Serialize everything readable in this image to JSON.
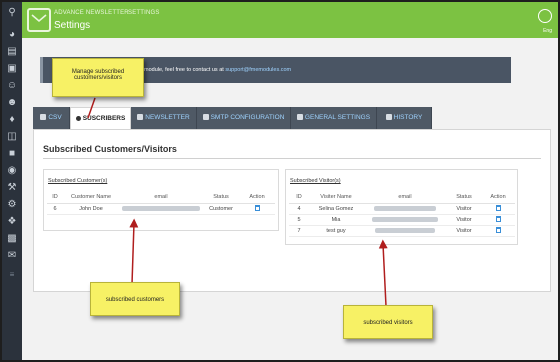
{
  "header": {
    "breadcrumb": [
      "ADVANCE NEWSLETTER",
      "SETTINGS"
    ],
    "title": "Settings",
    "lang": "Eng",
    "color": "#7cc242"
  },
  "sidebar": {
    "icons": [
      "search-icon",
      "dashboard-icon",
      "catalog-icon",
      "orders-icon",
      "customers-icon",
      "users-icon",
      "tags-icon",
      "cart-icon",
      "shipping-icon",
      "globe-icon",
      "wrench-icon",
      "settings-icon",
      "modules-icon",
      "stats-icon",
      "mail-icon",
      "collapse-icon"
    ]
  },
  "info": {
    "text_prefix": "module, feel free to contact us at",
    "email": "support@fmemodules.com"
  },
  "tabs": [
    {
      "label": "CSV",
      "icon": "csv-icon"
    },
    {
      "label": "SUSCRIBERS",
      "icon": "user-icon"
    },
    {
      "label": "NEWSLETTER",
      "icon": "newsletter-icon"
    },
    {
      "label": "SMTP CONFIGURATION",
      "icon": "smtp-icon"
    },
    {
      "label": "GENERAL SETTINGS",
      "icon": "settings-icon"
    },
    {
      "label": "HISTORY",
      "icon": "history-icon"
    }
  ],
  "panel": {
    "title": "Subscribed Customers/Visitors"
  },
  "customers": {
    "title": "Subscribed Customer(s)",
    "columns": [
      "ID",
      "Customer Name",
      "email",
      "Status",
      "Action"
    ],
    "rows": [
      {
        "id": "6",
        "name": "John Doe",
        "status": "Customer"
      }
    ]
  },
  "visitors": {
    "title": "Subscribed Visitor(s)",
    "columns": [
      "ID",
      "Visiter Name",
      "email",
      "Status",
      "Action"
    ],
    "rows": [
      {
        "id": "4",
        "name": "Selina Gomez",
        "status": "Visitor"
      },
      {
        "id": "5",
        "name": "Mia",
        "status": "Visitor"
      },
      {
        "id": "7",
        "name": "test guy",
        "status": "Visitor"
      }
    ]
  },
  "callouts": {
    "manage": "Manage subscribed customers/visitors",
    "customers": "subscribed customers",
    "visitors": "subscribed visitors"
  }
}
